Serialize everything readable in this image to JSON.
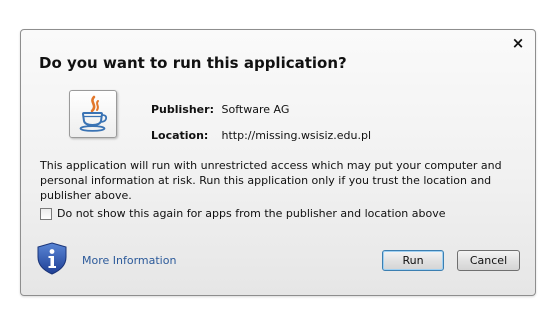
{
  "dialog": {
    "title": "Do you want to run this application?",
    "close_label": "×",
    "app_icon": "java-icon",
    "publisher": {
      "label": "Publisher:",
      "value": "Software AG"
    },
    "location": {
      "label": "Location:",
      "value": "http://missing.wsisiz.edu.pl"
    },
    "warning_text": "This application will run with unrestricted access which may put your computer and personal information at risk. Run this application only if you trust the location and publisher above.",
    "checkbox": {
      "label": "Do not show this again for apps from the publisher and location above",
      "checked": false
    },
    "info_icon": "info-shield-icon",
    "more_info_label": "More Information",
    "buttons": {
      "run": "Run",
      "cancel": "Cancel"
    },
    "colors": {
      "link": "#2c5a9a",
      "shield": "#2a52a8"
    }
  }
}
